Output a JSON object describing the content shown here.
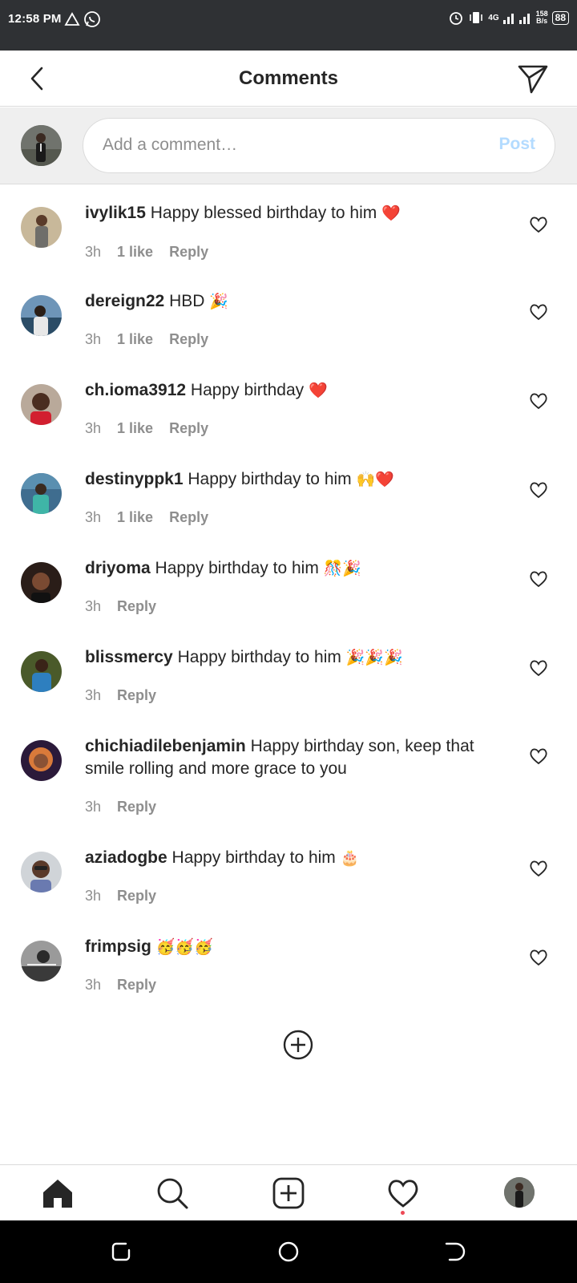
{
  "status_bar": {
    "time": "12:58 PM",
    "network": "4G",
    "speed_top": "158",
    "speed_bottom": "B/s",
    "battery": "88"
  },
  "header": {
    "title": "Comments"
  },
  "compose": {
    "placeholder": "Add a comment…",
    "post_label": "Post",
    "post_color": "#b3dbff"
  },
  "comments": [
    {
      "username": "ivylik15",
      "text": "Happy blessed birthday to him",
      "emoji": "❤️",
      "time": "3h",
      "likes": "1 like",
      "reply": "Reply"
    },
    {
      "username": "dereign22",
      "text": "HBD",
      "emoji": "🎉",
      "time": "3h",
      "likes": "1 like",
      "reply": "Reply"
    },
    {
      "username": "ch.ioma3912",
      "text": "Happy birthday",
      "emoji": "❤️",
      "time": "3h",
      "likes": "1 like",
      "reply": "Reply"
    },
    {
      "username": "destinyppk1",
      "text": "Happy birthday to him",
      "emoji": "🙌❤️",
      "time": "3h",
      "likes": "1 like",
      "reply": "Reply"
    },
    {
      "username": "driyoma",
      "text": "Happy birthday to him",
      "emoji": "🎊🎉",
      "time": "3h",
      "likes": "",
      "reply": "Reply"
    },
    {
      "username": "blissmercy",
      "text": "Happy birthday to him",
      "emoji": "🎉🎉🎉",
      "time": "3h",
      "likes": "",
      "reply": "Reply"
    },
    {
      "username": "chichiadilebenjamin",
      "text": "Happy birthday son, keep that smile rolling and more grace to you",
      "emoji": "",
      "time": "3h",
      "likes": "",
      "reply": "Reply"
    },
    {
      "username": "aziadogbe",
      "text": "Happy birthday to him",
      "emoji": "🎂",
      "time": "3h",
      "likes": "",
      "reply": "Reply"
    },
    {
      "username": "frimpsig",
      "text": "",
      "emoji": "🥳🥳🥳",
      "time": "3h",
      "likes": "",
      "reply": "Reply"
    }
  ],
  "icons": {
    "back": "back-arrow-icon",
    "send": "direct-send-icon",
    "heart": "heart-outline-icon",
    "load_more": "plus-circle-icon",
    "nav": [
      "home-icon",
      "search-icon",
      "new-post-icon",
      "activity-heart-icon",
      "profile-avatar"
    ]
  },
  "colors": {
    "status_bar": "#2f3134",
    "notification_dot": "#ed4956",
    "muted_text": "#8e8e8e"
  }
}
